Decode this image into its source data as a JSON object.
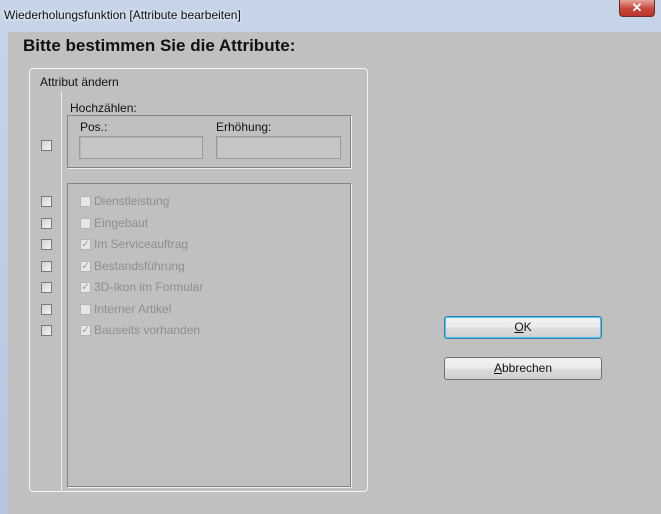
{
  "window": {
    "title": "Wiederholungsfunktion [Attribute bearbeiten]"
  },
  "dialog": {
    "heading": "Bitte bestimmen Sie die Attribute:",
    "group_title": "Attribut ändern",
    "increment": {
      "label": "Hochzählen:",
      "pos_label": "Pos.:",
      "increase_label": "Erhöhung:",
      "pos_value": "",
      "increase_value": ""
    },
    "attributes": [
      {
        "label": "Dienstleistung",
        "checked": false
      },
      {
        "label": "Eingebaut",
        "checked": false
      },
      {
        "label": "Im Serviceauftrag",
        "checked": true
      },
      {
        "label": "Bestandsführung",
        "checked": true
      },
      {
        "label": "3D-Ikon im Formular",
        "checked": true
      },
      {
        "label": "Interner Artikel",
        "checked": false
      },
      {
        "label": "Bauseits vorhanden",
        "checked": true
      }
    ],
    "buttons": {
      "ok_mnemonic": "O",
      "ok_rest": "K",
      "cancel_mnemonic": "A",
      "cancel_rest": "bbrechen"
    }
  },
  "icons": {
    "close": "close-icon",
    "check": "checkmark-icon"
  }
}
